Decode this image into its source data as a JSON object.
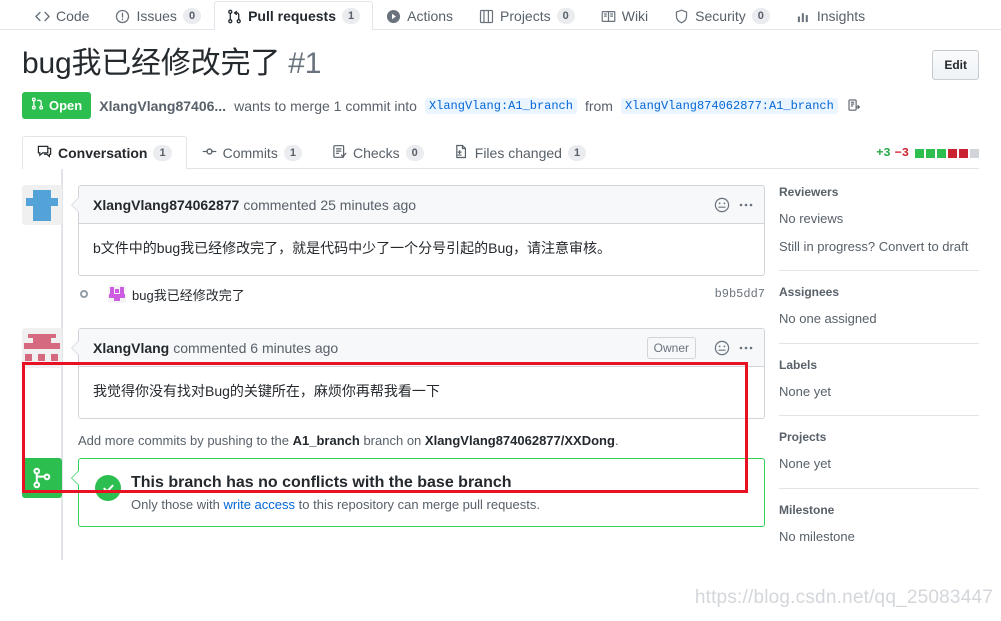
{
  "repo_nav": {
    "items": [
      {
        "label": "Code",
        "icon": "code-icon",
        "count": null,
        "selected": false
      },
      {
        "label": "Issues",
        "icon": "issue-opened-icon",
        "count": "0",
        "selected": false
      },
      {
        "label": "Pull requests",
        "icon": "git-pull-request-icon",
        "count": "1",
        "selected": true
      },
      {
        "label": "Actions",
        "icon": "play-icon",
        "count": null,
        "selected": false
      },
      {
        "label": "Projects",
        "icon": "project-icon",
        "count": "0",
        "selected": false
      },
      {
        "label": "Wiki",
        "icon": "book-icon",
        "count": null,
        "selected": false
      },
      {
        "label": "Security",
        "icon": "shield-icon",
        "count": "0",
        "selected": false
      },
      {
        "label": "Insights",
        "icon": "graph-icon",
        "count": null,
        "selected": false
      }
    ]
  },
  "header": {
    "title": "bug我已经修改完了",
    "number": "#1",
    "edit_label": "Edit",
    "state": "Open",
    "state_color": "#2cbe4e",
    "author": "XlangVlang87406...",
    "merge_text_1": "wants to merge 1 commit into",
    "base_branch": "XlangVlang:A1_branch",
    "merge_text_2": "from",
    "head_branch": "XlangVlang874062877:A1_branch",
    "copy_icon": "clipboard-copy-icon"
  },
  "pr_tabs": {
    "items": [
      {
        "label": "Conversation",
        "icon": "comment-discussion-icon",
        "count": "1",
        "selected": true
      },
      {
        "label": "Commits",
        "icon": "git-commit-icon",
        "count": "1",
        "selected": false
      },
      {
        "label": "Checks",
        "icon": "checklist-icon",
        "count": "0",
        "selected": false
      },
      {
        "label": "Files changed",
        "icon": "file-diff-icon",
        "count": "1",
        "selected": false
      }
    ],
    "diffstat": {
      "additions": "+3",
      "deletions": "−3",
      "blocks": [
        "g",
        "g",
        "g",
        "r",
        "r",
        "n"
      ],
      "add_color": "#28a745",
      "del_color": "#cb2431"
    }
  },
  "timeline": {
    "comment1": {
      "author": "XlangVlang874062877",
      "meta": "commented 25 minutes ago",
      "body": "b文件中的bug我已经修改完了，就是代码中少了一个分号引起的Bug，请注意审核。",
      "reaction_icon": "smiley-icon",
      "menu_icon": "kebab-horizontal-icon",
      "avatar_color": "#54a3d8"
    },
    "commit": {
      "message": "bug我已经修改完了",
      "sha": "b9b5dd7",
      "avatar_color": "#cc5ce0",
      "dot_icon": "git-commit-dot-icon"
    },
    "comment2": {
      "author": "XlangVlang",
      "meta": "commented 6 minutes ago",
      "body": "我觉得你没有找对Bug的关键所在，麻烦你再帮我看一下",
      "owner_badge": "Owner",
      "reaction_icon": "smiley-icon",
      "menu_icon": "kebab-horizontal-icon",
      "avatar_color": "#d4697f",
      "highlight_color": "#e81123"
    },
    "add_commits": {
      "pre": "Add more commits by pushing to the",
      "branch": "A1_branch",
      "mid": "branch on",
      "repo": "XlangVlang874062877/XXDong",
      "post": "."
    },
    "merge_status": {
      "icon": "git-merge-icon",
      "check_icon": "check-icon",
      "title": "This branch has no conflicts with the base branch",
      "sub_pre": "Only those with",
      "sub_link": "write access",
      "sub_post": "to this repository can merge pull requests.",
      "accent": "#2cbe4e"
    }
  },
  "sidebar": {
    "sections": [
      {
        "heading": "Reviewers",
        "values": [
          "No reviews",
          "Still in progress? Convert to draft"
        ]
      },
      {
        "heading": "Assignees",
        "values": [
          "No one assigned"
        ]
      },
      {
        "heading": "Labels",
        "values": [
          "None yet"
        ]
      },
      {
        "heading": "Projects",
        "values": [
          "None yet"
        ]
      },
      {
        "heading": "Milestone",
        "values": [
          "No milestone"
        ]
      }
    ]
  },
  "watermark": "https://blog.csdn.net/qq_25083447"
}
